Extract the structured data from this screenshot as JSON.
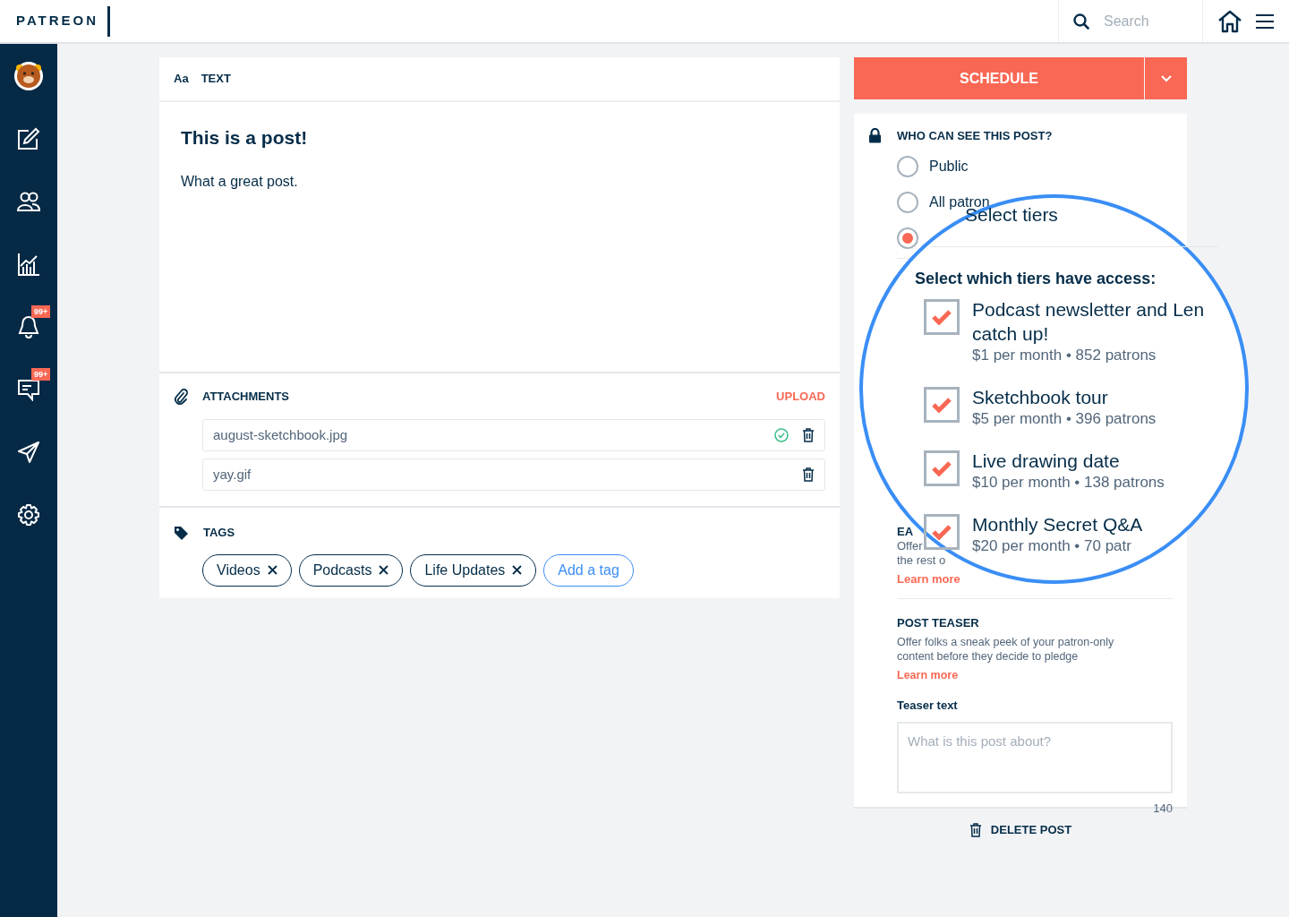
{
  "header": {
    "logo": "PATREON",
    "search": {
      "placeholder": "Search"
    }
  },
  "sidebar": {
    "items": [
      {
        "kind": "avatar"
      },
      {
        "kind": "edit"
      },
      {
        "kind": "people"
      },
      {
        "kind": "chart"
      },
      {
        "kind": "bell",
        "badge": "99+"
      },
      {
        "kind": "chat",
        "badge": "99+"
      },
      {
        "kind": "send"
      },
      {
        "kind": "settings"
      }
    ]
  },
  "editor": {
    "type_icon": "Aa",
    "type_label": "TEXT",
    "title": "This is a post!",
    "body": "What a great post.",
    "attachments": {
      "heading": "ATTACHMENTS",
      "action": "UPLOAD",
      "files": [
        {
          "name": "august-sketchbook.jpg",
          "uploaded": true
        },
        {
          "name": "yay.gif",
          "uploaded": false
        }
      ]
    },
    "tags": {
      "heading": "TAGS",
      "items": [
        "Videos",
        "Podcasts",
        "Life Updates"
      ],
      "add": "Add a tag"
    }
  },
  "schedule_button": "SCHEDULE",
  "visibility": {
    "heading": "WHO CAN SEE THIS POST?",
    "options": [
      {
        "label": "Public",
        "selected": false
      },
      {
        "label": "All patron",
        "selected": false
      },
      {
        "selected": true
      }
    ]
  },
  "early_access": {
    "heading": "EA",
    "lines": [
      "Offer",
      "the rest o"
    ],
    "link": "Learn more"
  },
  "teaser": {
    "heading": "POST TEASER",
    "description": "Offer folks a sneak peek of your patron-only content before they decide to pledge",
    "link": "Learn more",
    "field_label": "Teaser text",
    "placeholder": "What is this post about?",
    "counter": "140"
  },
  "delete_button": "DELETE POST",
  "magnifier": {
    "title": "Select tiers",
    "prompt": "Select which tiers have access:",
    "tiers": [
      {
        "name_lines": [
          "Podcast newsletter and Len",
          "catch up!"
        ],
        "detail": "$1 per month • 852 patrons",
        "checked": true
      },
      {
        "name_lines": [
          "Sketchbook tour"
        ],
        "detail": "$5 per month • 396 patrons",
        "checked": true
      },
      {
        "name_lines": [
          "Live drawing date"
        ],
        "detail": "$10 per month • 138 patrons",
        "checked": true
      },
      {
        "name_lines": [
          "Monthly Secret Q&A"
        ],
        "detail": "$20 per month • 70 patr",
        "checked": true
      }
    ]
  }
}
